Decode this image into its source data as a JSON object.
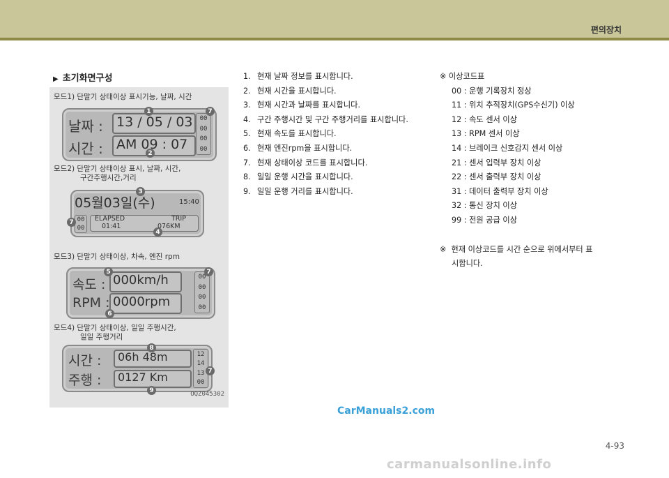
{
  "header": {
    "title": "편의장치"
  },
  "section": {
    "marker": "▶",
    "title": "초기화면구성"
  },
  "figure": {
    "id": "OQZ045302",
    "modes": [
      {
        "caption": "모드1) 단말기 상태이상 표시기능, 날짜, 시간",
        "row1_label": "날짜 :",
        "row1_value": "13 / 05 / 03",
        "row2_label": "시간 :",
        "row2_value": "AM  09 : 07",
        "codes": [
          "00",
          "00",
          "00",
          "00"
        ],
        "badges": [
          "1",
          "2",
          "7"
        ]
      },
      {
        "caption_line1": "모드2) 단말기 상태이상 표시, 날짜, 시간,",
        "caption_line2": "구간주행시간,거리",
        "date": "05월03일(수)",
        "time": "15:40",
        "codes": [
          "00",
          "00"
        ],
        "elapsed_label": "ELAPSED",
        "elapsed_value": "01:41",
        "trip_label": "TRIP",
        "trip_value": "076KM",
        "badges": [
          "3",
          "7",
          "4"
        ]
      },
      {
        "caption": "모드3) 단말기 상태이상, 차속, 엔진 rpm",
        "row1_label": "속도 :",
        "row1_value": "000km/h",
        "row2_label": "RPM :",
        "row2_value": "0000rpm",
        "codes": [
          "00",
          "00",
          "00",
          "00"
        ],
        "badges": [
          "5",
          "6",
          "7"
        ]
      },
      {
        "caption_line1": "모드4) 단말기 상태이상, 일일 주행시간,",
        "caption_line2": "일일 주행거리",
        "row1_label": "시간 :",
        "row1_value": "06h 48m",
        "row2_label": "주행 :",
        "row2_value": "0127 Km",
        "codes": [
          "12",
          "14",
          "13",
          "00"
        ],
        "badges": [
          "8",
          "9",
          "7"
        ]
      }
    ]
  },
  "list": [
    {
      "num": "1.",
      "text": "현재 날짜 정보를 표시합니다."
    },
    {
      "num": "2.",
      "text": "현재 시간을 표시합니다."
    },
    {
      "num": "3.",
      "text": "현재 시간과 날짜를 표시합니다."
    },
    {
      "num": "4.",
      "text": "구간 주행시간 및 구간 주행거리를 표시합니다."
    },
    {
      "num": "5.",
      "text": "현재 속도를 표시합니다."
    },
    {
      "num": "6.",
      "text": "현재 엔진rpm을 표시합니다."
    },
    {
      "num": "7.",
      "text": "현재 상태이상 코드를 표시합니다."
    },
    {
      "num": "8.",
      "text": "일일 운행 시간을 표시합니다."
    },
    {
      "num": "9.",
      "text": "일일 운행 거리를 표시합니다."
    }
  ],
  "code_table": {
    "title": "※  이상코드표",
    "rows": [
      "00 : 운행 기록장치 정상",
      "11 : 위치 추적장치(GPS수신기) 이상",
      "12 :  속도 센서 이상",
      "13 : RPM 센서 이상",
      "14 : 브레이크 신호감지 센서 이상",
      "21 : 센서 입력부 장치 이상",
      "22 : 센서 출력부 장치 이상",
      "31 : 데이터 출력부 장치 이상",
      "32 : 통신 장치 이상",
      "99 : 전원 공급 이상"
    ]
  },
  "note": {
    "mark": "※",
    "line1": "현재 이상코드를 시간 순으로 위에서부터 표",
    "line2": "시합니다."
  },
  "watermark": "CarManuals2.com",
  "page_number": "4-93",
  "footer_watermark": "carmanualsonline.info"
}
